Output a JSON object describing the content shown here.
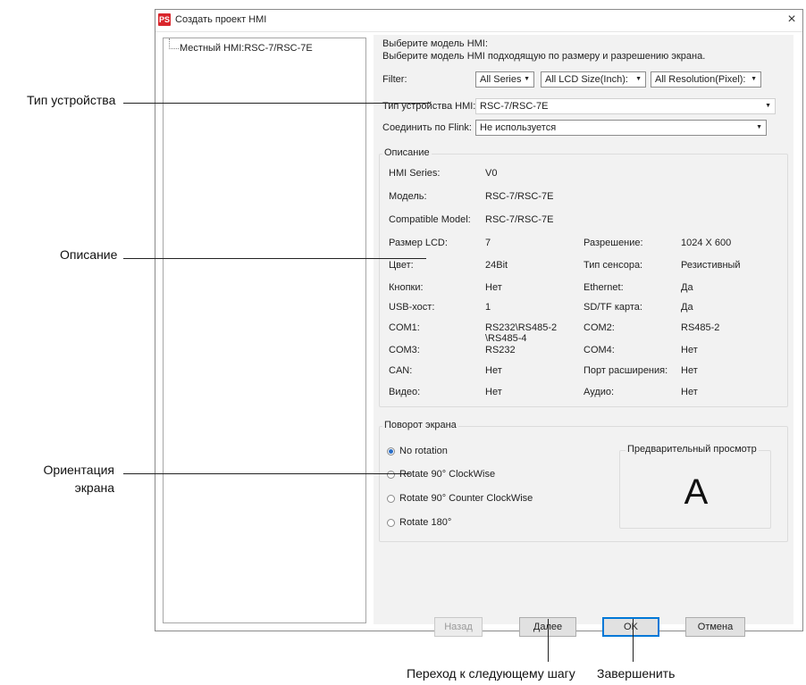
{
  "dialog": {
    "logo": "PS",
    "title": "Создать проект HMI",
    "close": "×"
  },
  "tree": {
    "item": "Местный HMI:RSC-7/RSC-7E"
  },
  "header": {
    "line1": "Выберите модель HMI:",
    "line2": "Выберите модель HMI подходящую по размеру и разрешению экрана."
  },
  "filter": {
    "label": "Filter:",
    "series": "All Series",
    "lcd": "All LCD Size(Inch):",
    "resolution": "All Resolution(Pixel):"
  },
  "device": {
    "label": "Тип устройства HMI:",
    "value": "RSC-7/RSC-7E"
  },
  "flink": {
    "label": "Соединить по Flink:",
    "value": "Не используется"
  },
  "description": {
    "title": "Описание",
    "rows": [
      {
        "l1": "HMI Series:",
        "v1": "V0",
        "l2": "",
        "v2": ""
      },
      {
        "l1": "Модель:",
        "v1": "RSC-7/RSC-7E",
        "l2": "",
        "v2": ""
      },
      {
        "l1": "Compatible Model:",
        "v1": "RSC-7/RSC-7E",
        "l2": "",
        "v2": ""
      },
      {
        "l1": "Размер LCD:",
        "v1": "7",
        "l2": "Разрешение:",
        "v2": "1024 X 600"
      },
      {
        "l1": "Цвет:",
        "v1": "24Bit",
        "l2": "Тип сенсора:",
        "v2": "Резистивный"
      },
      {
        "l1": "Кнопки:",
        "v1": "Нет",
        "l2": "Ethernet:",
        "v2": "Да"
      },
      {
        "l1": "USB-хост:",
        "v1": "1",
        "l2": "SD/TF карта:",
        "v2": "Да"
      },
      {
        "l1": "COM1:",
        "v1": "RS232\\RS485-2 \\RS485-4",
        "l2": "COM2:",
        "v2": "RS485-2"
      },
      {
        "l1": "COM3:",
        "v1": "RS232",
        "l2": "COM4:",
        "v2": "Нет"
      },
      {
        "l1": "CAN:",
        "v1": "Нет",
        "l2": "Порт расширения:",
        "v2": "Нет"
      },
      {
        "l1": "Видео:",
        "v1": "Нет",
        "l2": "Аудио:",
        "v2": "Нет"
      }
    ]
  },
  "rotation": {
    "title": "Поворот экрана",
    "options": [
      "No rotation",
      "Rotate 90° ClockWise",
      "Rotate 90° Counter ClockWise",
      "Rotate 180°"
    ],
    "selected_index": 0,
    "preview_title": "Предварительный просмотр",
    "preview_char": "A"
  },
  "buttons": {
    "back": "Назад",
    "next": "Далее",
    "ok": "OK",
    "cancel": "Отмена"
  },
  "callouts": {
    "device_type": "Тип устройства",
    "description": "Описание",
    "orientation": "Ориентация экрана",
    "next_step": "Переход к следующему шагу",
    "finish": "Завершенить"
  },
  "colors": {
    "logo": "#d9262c",
    "primary_border": "#0078d7",
    "panel_bg": "#f2f2f2"
  }
}
